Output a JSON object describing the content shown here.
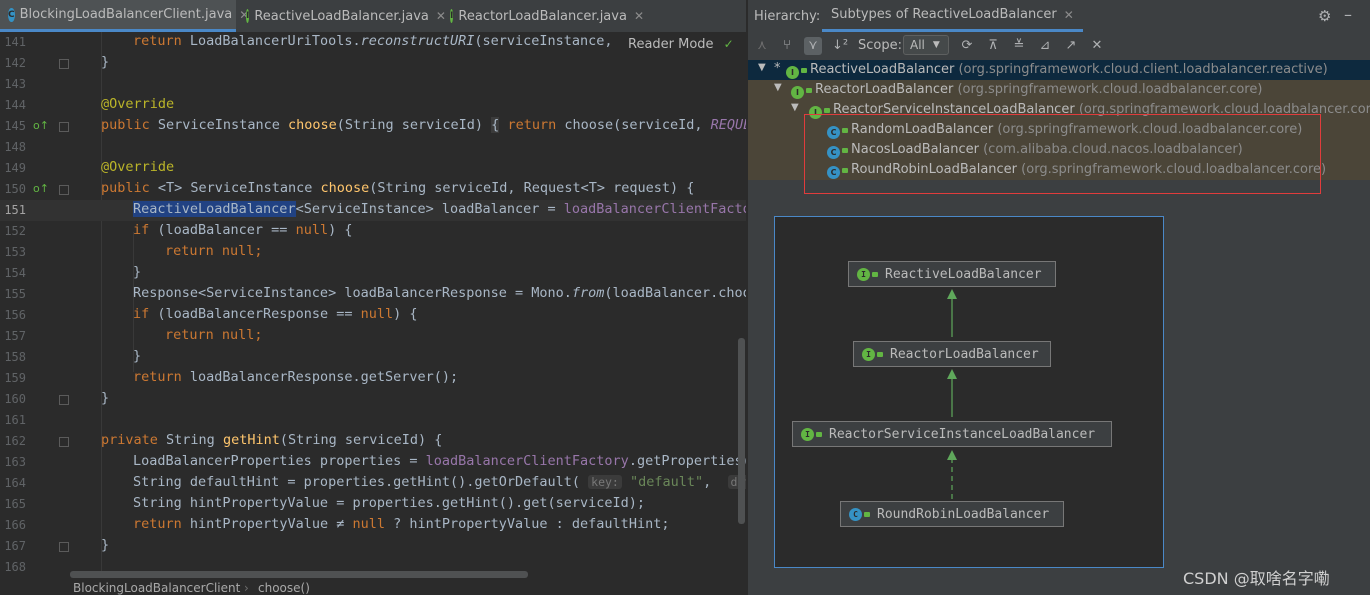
{
  "tabs": [
    {
      "label": "BlockingLoadBalancerClient.java",
      "icon": "class-icon",
      "icon_letter": "C",
      "active": true
    },
    {
      "label": "ReactiveLoadBalancer.java",
      "icon": "interface-icon",
      "icon_letter": "I",
      "active": false
    },
    {
      "label": "ReactorLoadBalancer.java",
      "icon": "interface-icon",
      "icon_letter": "I",
      "active": false
    }
  ],
  "editor": {
    "reader_mode_label": "Reader Mode",
    "lines": [
      {
        "n": "141",
        "text": "    return LoadBalancerUriTools.reconstructURI(serviceInstance,"
      },
      {
        "n": "142",
        "text": "}"
      },
      {
        "n": "143",
        "text": ""
      },
      {
        "n": "144",
        "text": "@Override"
      },
      {
        "n": "145",
        "text": "public ServiceInstance choose(String serviceId) { return choose(serviceId, REQUES"
      },
      {
        "n": "148",
        "text": ""
      },
      {
        "n": "149",
        "text": "@Override"
      },
      {
        "n": "150",
        "text": "public <T> ServiceInstance choose(String serviceId, Request<T> request) {"
      },
      {
        "n": "151",
        "text": "    ReactiveLoadBalancer<ServiceInstance> loadBalancer = loadBalancerClientFactor"
      },
      {
        "n": "152",
        "text": "    if (loadBalancer == null) {"
      },
      {
        "n": "153",
        "text": "        return null;"
      },
      {
        "n": "154",
        "text": "    }"
      },
      {
        "n": "155",
        "text": "    Response<ServiceInstance> loadBalancerResponse = Mono.from(loadBalancer.choos"
      },
      {
        "n": "156",
        "text": "    if (loadBalancerResponse == null) {"
      },
      {
        "n": "157",
        "text": "        return null;"
      },
      {
        "n": "158",
        "text": "    }"
      },
      {
        "n": "159",
        "text": "    return loadBalancerResponse.getServer();"
      },
      {
        "n": "160",
        "text": "}"
      },
      {
        "n": "161",
        "text": ""
      },
      {
        "n": "162",
        "text": "private String getHint(String serviceId) {"
      },
      {
        "n": "163",
        "text": "    LoadBalancerProperties properties = loadBalancerClientFactory.getProperties(s"
      },
      {
        "n": "164",
        "text": "    String defaultHint = properties.getHint().getOrDefault( key: \"default\",  default"
      },
      {
        "n": "165",
        "text": "    String hintPropertyValue = properties.getHint().get(serviceId);"
      },
      {
        "n": "166",
        "text": "    return hintPropertyValue != null ? hintPropertyValue : defaultHint;"
      },
      {
        "n": "167",
        "text": "}"
      },
      {
        "n": "168",
        "text": ""
      }
    ],
    "breadcrumb": [
      "BlockingLoadBalancerClient",
      "choose()"
    ],
    "current_line": "151"
  },
  "hierarchy": {
    "title": "Hierarchy:",
    "tab_label": "Subtypes of ReactiveLoadBalancer",
    "scope_label": "Scope:",
    "scope_value": "All",
    "tree": [
      {
        "name": "ReactiveLoadBalancer",
        "pkg": "(org.springframework.cloud.client.loadbalancer.reactive)",
        "kind": "I",
        "level": 0,
        "selected": true,
        "marker": "*"
      },
      {
        "name": "ReactorLoadBalancer",
        "pkg": "(org.springframework.cloud.loadbalancer.core)",
        "kind": "I",
        "level": 1
      },
      {
        "name": "ReactorServiceInstanceLoadBalancer",
        "pkg": "(org.springframework.cloud.loadbalancer.core)",
        "kind": "I",
        "level": 2
      },
      {
        "name": "RandomLoadBalancer",
        "pkg": "(org.springframework.cloud.loadbalancer.core)",
        "kind": "C",
        "level": 3
      },
      {
        "name": "NacosLoadBalancer",
        "pkg": "(com.alibaba.cloud.nacos.loadbalancer)",
        "kind": "C",
        "level": 3
      },
      {
        "name": "RoundRobinLoadBalancer",
        "pkg": "(org.springframework.cloud.loadbalancer.core)",
        "kind": "C",
        "level": 3
      }
    ]
  },
  "diagram": {
    "nodes": [
      {
        "label": "ReactiveLoadBalancer",
        "kind": "I"
      },
      {
        "label": "ReactorLoadBalancer",
        "kind": "I"
      },
      {
        "label": "ReactorServiceInstanceLoadBalancer",
        "kind": "I"
      },
      {
        "label": "RoundRobinLoadBalancer",
        "kind": "C"
      }
    ]
  },
  "watermark": "CSDN @取啥名字嘞",
  "colors": {
    "accent": "#4a88c7",
    "highlight_box": "#e03c3c",
    "interface_icon": "#62b543",
    "class_icon": "#3592c4"
  }
}
